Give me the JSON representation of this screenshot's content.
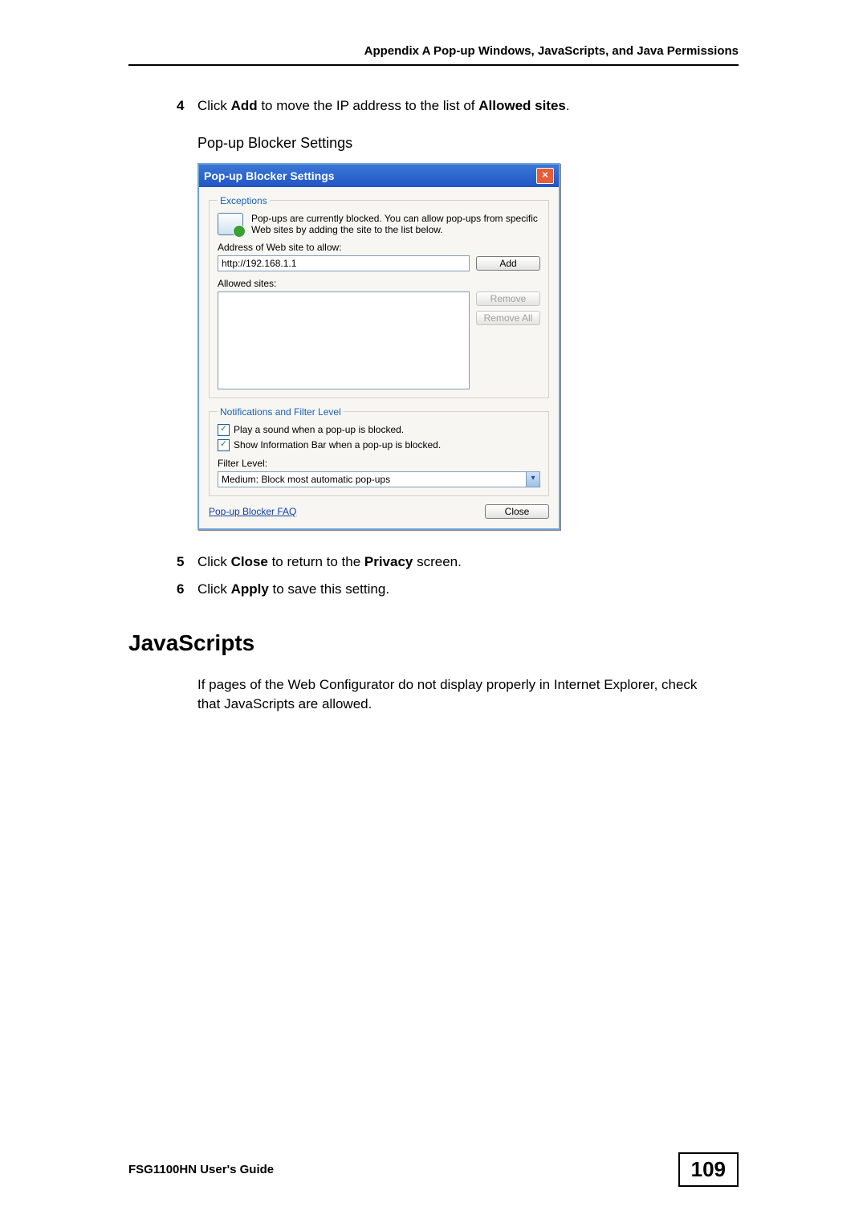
{
  "header": "Appendix A Pop-up Windows, JavaScripts, and Java Permissions",
  "step4": {
    "num": "4",
    "pre": "Click ",
    "b1": "Add",
    "mid": " to move the IP address to the list of ",
    "b2": "Allowed sites",
    "post": "."
  },
  "figure_caption": "Pop-up Blocker Settings",
  "dialog": {
    "title": "Pop-up Blocker Settings",
    "exceptions_legend": "Exceptions",
    "desc": "Pop-ups are currently blocked. You can allow pop-ups from specific Web sites by adding the site to the list below.",
    "address_label": "Address of Web site to allow:",
    "address_value": "http://192.168.1.1",
    "add_btn": "Add",
    "allowed_label": "Allowed sites:",
    "remove_btn": "Remove",
    "remove_all_btn": "Remove All",
    "notif_legend": "Notifications and Filter Level",
    "chk1": "Play a sound when a pop-up is blocked.",
    "chk2": "Show Information Bar when a pop-up is blocked.",
    "filter_label": "Filter Level:",
    "filter_value": "Medium: Block most automatic pop-ups",
    "faq_link": "Pop-up Blocker FAQ",
    "close_btn": "Close"
  },
  "step5": {
    "num": "5",
    "pre": "Click ",
    "b1": "Close",
    "mid": " to return to the ",
    "b2": "Privacy",
    "post": " screen."
  },
  "step6": {
    "num": "6",
    "pre": "Click ",
    "b1": "Apply",
    "post": " to save this setting."
  },
  "section_heading": "JavaScripts",
  "section_body": "If pages of the Web Configurator do not display properly in Internet Explorer, check that JavaScripts are allowed.",
  "footer_left": "FSG1100HN User's Guide",
  "page_number": "109"
}
